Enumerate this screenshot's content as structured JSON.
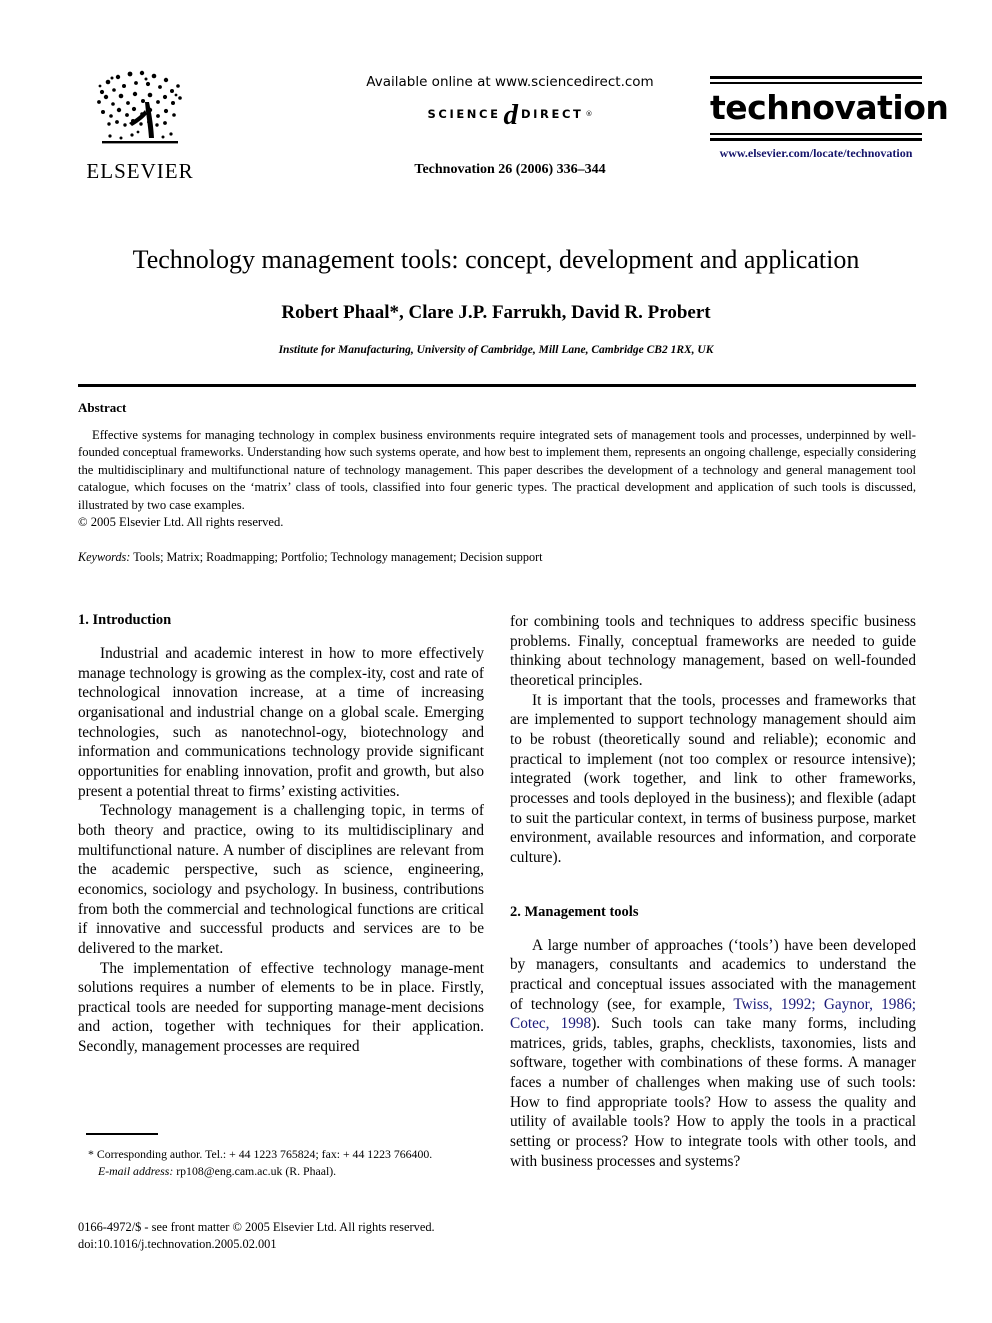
{
  "masthead": {
    "publisher_logo_name": "ELSEVIER",
    "available_online": "Available online at www.sciencedirect.com",
    "sciencedirect": {
      "word1": "SCIENCE",
      "at_symbol": "d",
      "word2": "DIRECT",
      "registered": "®"
    },
    "journal_reference": "Technovation 26 (2006) 336–344",
    "journal_name": "technovation",
    "journal_url": "www.elsevier.com/locate/technovation"
  },
  "title_block": {
    "title": "Technology management tools: concept, development and application",
    "authors": "Robert Phaal*, Clare J.P. Farrukh, David R. Probert",
    "affiliation": "Institute for Manufacturing, University of Cambridge, Mill Lane, Cambridge CB2 1RX, UK"
  },
  "abstract": {
    "heading": "Abstract",
    "body": "Effective systems for managing technology in complex business environments require integrated sets of management tools and processes, underpinned by well-founded conceptual frameworks. Understanding how such systems operate, and how best to implement them, represents an ongoing challenge, especially considering the multidisciplinary and multifunctional nature of technology management. This paper describes the development of a technology and general management tool catalogue, which focuses on the ‘matrix’ class of tools, classified into four generic types. The practical development and application of such tools is discussed, illustrated by two case examples.",
    "copyright": "© 2005 Elsevier Ltd. All rights reserved.",
    "keywords_label": "Keywords:",
    "keywords_value": "Tools; Matrix; Roadmapping; Portfolio; Technology management; Decision support"
  },
  "sections": {
    "introduction_heading": "1. Introduction",
    "intro_p1": "Industrial and academic interest in how to more effectively manage technology is growing as the complex-ity, cost and rate of technological innovation increase, at a time of increasing organisational and industrial change on a global scale. Emerging technologies, such as nanotechnol-ogy, biotechnology and information and communications technology provide significant opportunities for enabling innovation, profit and growth, but also present a potential threat to firms’ existing activities.",
    "intro_p2": "Technology management is a challenging topic, in terms of both theory and practice, owing to its multidisciplinary and multifunctional nature. A number of disciplines are relevant from the academic perspective, such as science, engineering, economics, sociology and psychology. In business, contributions from both the commercial and technological functions are critical if innovative and successful products and services are to be delivered to the market.",
    "intro_p3_part1": "The implementation of effective technology manage-ment solutions requires a number of elements to be in place. Firstly, practical tools are needed for supporting manage-ment decisions and action, together with techniques for their application. Secondly, management processes are required",
    "intro_p3_part2": "for combining tools and techniques to address specific business problems. Finally, conceptual frameworks are needed to guide thinking about technology management, based on well-founded theoretical principles.",
    "intro_p4": "It is important that the tools, processes and frameworks that are implemented to support technology management should aim to be robust (theoretically sound and reliable); economic and practical to implement (not too complex or resource intensive); integrated (work together, and link to other frameworks, processes and tools deployed in the business); and flexible (adapt to suit the particular context, in terms of business purpose, market environment, available resources and information, and corporate culture).",
    "management_tools_heading": "2. Management tools",
    "mgmt_p1_before_cite": "A large number of approaches (‘tools’) have been developed by managers, consultants and academics to understand the practical and conceptual issues associated with the management of technology (see, for example, ",
    "mgmt_p1_citation": "Twiss, 1992; Gaynor, 1986; Cotec, 1998",
    "mgmt_p1_after_cite": "). Such tools can take many forms, including matrices, grids, tables, graphs, checklists, taxonomies, lists and software, together with combinations of these forms. A manager faces a number of challenges when making use of such tools: How to find appropriate tools? How to assess the quality and utility of available tools? How to apply the tools in a practical setting or process? How to integrate tools with other tools, and with business processes and systems?"
  },
  "footnote": {
    "corresponding": "* Corresponding author. Tel.: + 44 1223 765824; fax: + 44 1223 766400.",
    "email_label": "E-mail address:",
    "email_value": "rp108@eng.cam.ac.uk (R. Phaal).",
    "issn_line": "0166-4972/$ - see front matter © 2005 Elsevier Ltd. All rights reserved.",
    "doi_line": "doi:10.1016/j.technovation.2005.02.001"
  },
  "colors": {
    "citation_blue": "#1a1a78",
    "journal_url_blue": "#15156b",
    "text_black": "#000000",
    "page_background": "#ffffff"
  }
}
